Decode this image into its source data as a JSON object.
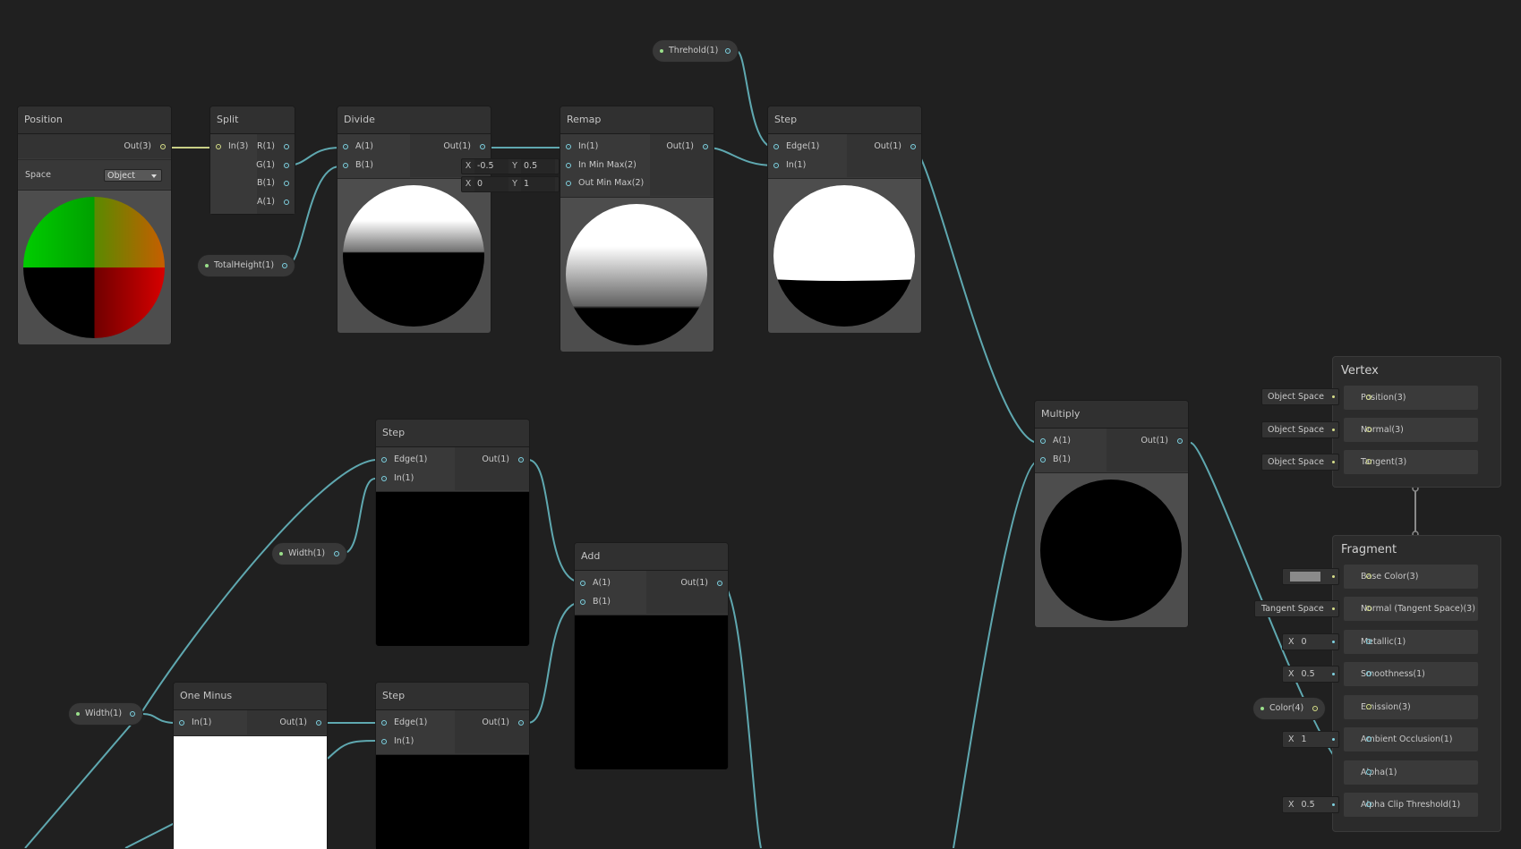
{
  "nodes": {
    "position": {
      "title": "Position",
      "out": "Out(3)",
      "space_label": "Space",
      "space_value": "Object"
    },
    "split": {
      "title": "Split",
      "in": "In(3)",
      "outs": [
        "R(1)",
        "G(1)",
        "B(1)",
        "A(1)"
      ]
    },
    "divide": {
      "title": "Divide",
      "a": "A(1)",
      "b": "B(1)",
      "out": "Out(1)"
    },
    "remap": {
      "title": "Remap",
      "in": "In(1)",
      "in_min_max": "In Min Max(2)",
      "out_min_max": "Out Min Max(2)",
      "out": "Out(1)",
      "in_x_label": "X",
      "in_x": "-0.5",
      "in_y_label": "Y",
      "in_y": "0.5",
      "out_x_label": "X",
      "out_x": "0",
      "out_y_label": "Y",
      "out_y": "1"
    },
    "step_top": {
      "title": "Step",
      "edge": "Edge(1)",
      "in": "In(1)",
      "out": "Out(1)"
    },
    "multiply": {
      "title": "Multiply",
      "a": "A(1)",
      "b": "B(1)",
      "out": "Out(1)"
    },
    "step_mid": {
      "title": "Step",
      "edge": "Edge(1)",
      "in": "In(1)",
      "out": "Out(1)"
    },
    "add": {
      "title": "Add",
      "a": "A(1)",
      "b": "B(1)",
      "out": "Out(1)"
    },
    "one_minus": {
      "title": "One Minus",
      "in": "In(1)",
      "out": "Out(1)"
    },
    "step_bottom": {
      "title": "Step",
      "edge": "Edge(1)",
      "in": "In(1)",
      "out": "Out(1)"
    }
  },
  "properties": {
    "threhold": "Threhold(1)",
    "total_height": "TotalHeight(1)",
    "width_upper": "Width(1)",
    "width_lower": "Width(1)",
    "color": "Color(4)"
  },
  "vertex": {
    "title": "Vertex",
    "slots": [
      {
        "label": "Position(3)",
        "control": "Object Space"
      },
      {
        "label": "Normal(3)",
        "control": "Object Space"
      },
      {
        "label": "Tangent(3)",
        "control": "Object Space"
      }
    ]
  },
  "fragment": {
    "title": "Fragment",
    "slots": [
      {
        "label": "Base Color(3)",
        "control": ""
      },
      {
        "label": "Normal (Tangent Space)(3)",
        "control": "Tangent Space"
      },
      {
        "label": "Metallic(1)",
        "control": "0",
        "control_label": "X"
      },
      {
        "label": "Smoothness(1)",
        "control": "0.5",
        "control_label": "X"
      },
      {
        "label": "Emission(3)",
        "control": ""
      },
      {
        "label": "Ambient Occlusion(1)",
        "control": "1",
        "control_label": "X"
      },
      {
        "label": "Alpha(1)",
        "control": ""
      },
      {
        "label": "Alpha Clip Threshold(1)",
        "control": "0.5",
        "control_label": "X"
      }
    ]
  },
  "colors": {
    "background": "#202020",
    "wire": "#5fa8b0",
    "wire_vec3": "#c9cf86",
    "accent_port": "#7fd1e0",
    "base_color_swatch": "#8a8a8a"
  }
}
